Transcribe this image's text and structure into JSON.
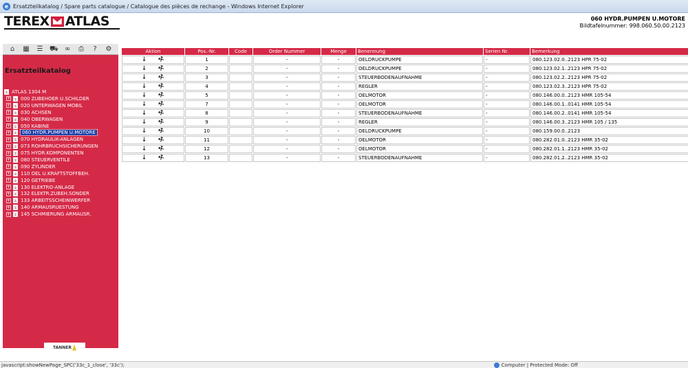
{
  "window": {
    "title": "Ersatzteilkatalog / Spare parts catalogue / Catalogue des pièces de rechange - Windows Internet Explorer"
  },
  "header": {
    "logo_left": "TEREX",
    "logo_right": "ATLAS",
    "group_title": "060 HYDR.PUMPEN U.MOTORE",
    "image_number": "Bildtafelnummer: 998.060.50.00.2123"
  },
  "toolbar": {
    "icons": [
      "home-icon",
      "catalog-icon",
      "list-icon",
      "cart-icon",
      "search-binoculars-icon",
      "print-icon",
      "help-icon",
      "tools-icon"
    ]
  },
  "sidebar": {
    "title": "Ersatzteilkatalog",
    "root_label": "ATLAS 1304 M",
    "items": [
      {
        "label": "000 ZUBEHOER U.SCHILDER"
      },
      {
        "label": "020 UNTERWAGEN MOBIL"
      },
      {
        "label": "030 ACHSEN"
      },
      {
        "label": "040 OBERWAGEN"
      },
      {
        "label": "050 KABINE"
      },
      {
        "label": "060 HYDR.PUMPEN U.MOTORE",
        "selected": true
      },
      {
        "label": "070 HYDRAULIK-ANLAGEN"
      },
      {
        "label": "073 ROHRBRUCHSICHERUNGEN"
      },
      {
        "label": "075 HYDR.KOMPONENTEN"
      },
      {
        "label": "080 STEUERVENTILE"
      },
      {
        "label": "090 ZYLINDER"
      },
      {
        "label": "110 OEL U.KRAFTSTOFFBEH."
      },
      {
        "label": "120 GETRIEBE"
      },
      {
        "label": "130 ELEKTRO-ANLAGE"
      },
      {
        "label": "132 ELEKTR.ZUBEH.SONDER"
      },
      {
        "label": "133 ARBEITSSCHEINWERFER"
      },
      {
        "label": "140 ARMAUSRUESTUNG"
      },
      {
        "label": "145 SCHMIERUNG ARMAUSR."
      }
    ],
    "footer_logo": "TANNER"
  },
  "table": {
    "headers": [
      "Aktion",
      "Pos.-Nr.",
      "Code",
      "Order Nummer",
      "Menge",
      "Benennung",
      "Serien Nr.",
      "Bemerkung"
    ],
    "rows": [
      {
        "pos": "1",
        "code": "",
        "order": "-",
        "menge": "-",
        "name": "OELDRUCKPUMPE",
        "serie": "-",
        "remark": "080.123.02.0..2123 HPR 75-02"
      },
      {
        "pos": "2",
        "code": "",
        "order": "-",
        "menge": "-",
        "name": "OELDRUCKPUMPE",
        "serie": "-",
        "remark": "080.123.02.1..2123 HPR 75-02"
      },
      {
        "pos": "3",
        "code": "",
        "order": "-",
        "menge": "-",
        "name": "STEUERBODENAUFNAHME",
        "serie": "-",
        "remark": "080.123.02.2..2123 HPR 75-02"
      },
      {
        "pos": "4",
        "code": "",
        "order": "-",
        "menge": "-",
        "name": "REGLER",
        "serie": "-",
        "remark": "080.123.02.3..2123 HPR 75-02"
      },
      {
        "pos": "5",
        "code": "",
        "order": "-",
        "menge": "-",
        "name": "OELMOTOR",
        "serie": "-",
        "remark": "080.146.00.0..2123 HMR 105-54"
      },
      {
        "pos": "7",
        "code": "",
        "order": "-",
        "menge": "-",
        "name": "OELMOTOR",
        "serie": "-",
        "remark": "080.146.00.1..0141 HMR 105-54"
      },
      {
        "pos": "8",
        "code": "",
        "order": "-",
        "menge": "-",
        "name": "STEUERBODENAUFNAHME",
        "serie": "-",
        "remark": "080.146.00.2..0141 HMR 105-54"
      },
      {
        "pos": "9",
        "code": "",
        "order": "-",
        "menge": "-",
        "name": "REGLER",
        "serie": "-",
        "remark": "080.146.00.3..2123 HMR 105 / 135"
      },
      {
        "pos": "10",
        "code": "",
        "order": "-",
        "menge": "-",
        "name": "OELDRUCKPUMPE",
        "serie": "-",
        "remark": "080.159.00.0..2123"
      },
      {
        "pos": "11",
        "code": "",
        "order": "-",
        "menge": "-",
        "name": "OELMOTOR",
        "serie": "-",
        "remark": "080.282.01.0..2123 HMR 35-02"
      },
      {
        "pos": "12",
        "code": "",
        "order": "-",
        "menge": "-",
        "name": "OELMOTOR",
        "serie": "-",
        "remark": "080.282.01.1..2123 HMR 35-02"
      },
      {
        "pos": "13",
        "code": "",
        "order": "-",
        "menge": "-",
        "name": "STEUERBODENAUFNAHME",
        "serie": "-",
        "remark": "080.282.01.2..2123 HMR 35-02"
      }
    ]
  },
  "status": {
    "left": "javascript:showNewPage_SPC('33c_1_close', '33c');",
    "right": "Computer | Protected Mode: Off"
  }
}
